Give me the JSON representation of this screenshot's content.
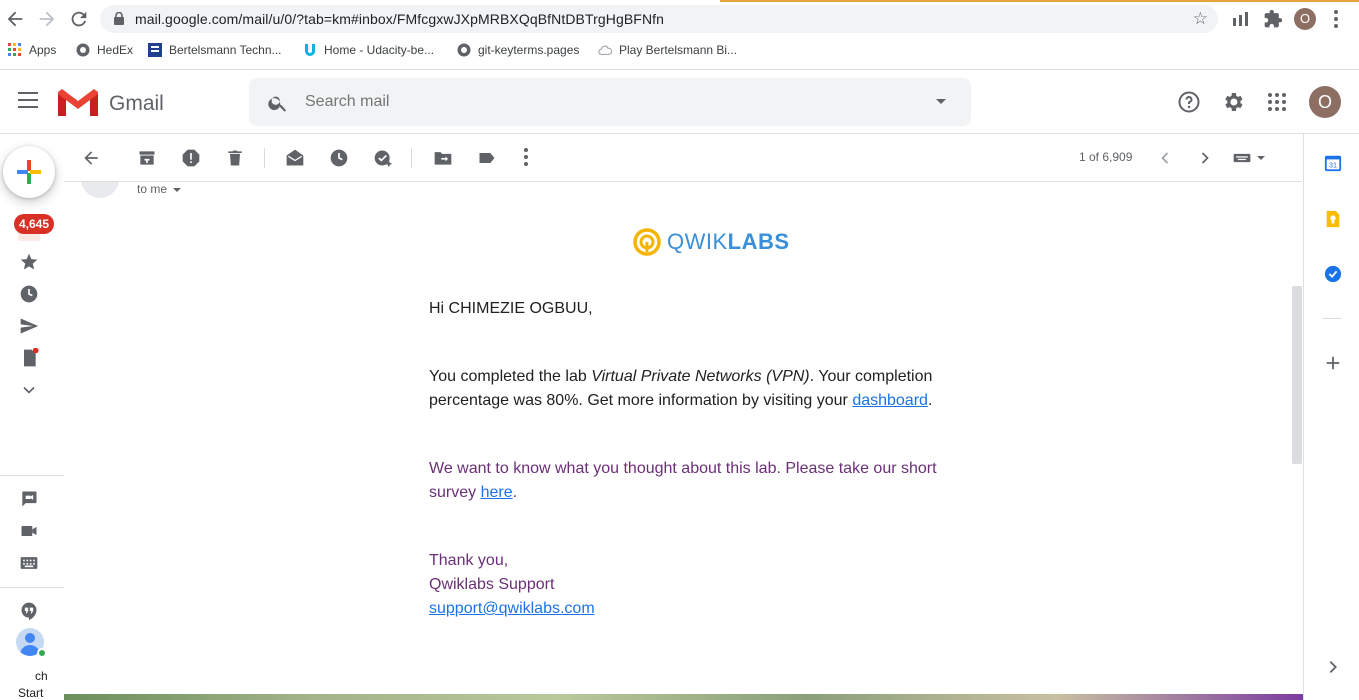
{
  "browser": {
    "url": "mail.google.com/mail/u/0/?tab=km#inbox/FMfcgxwJXpMRBXQqBfNtDBTrgHgBFNfn",
    "profile_initial": "O",
    "bookmarks": [
      {
        "label": "Apps"
      },
      {
        "label": "HedEx"
      },
      {
        "label": "Bertelsmann Techn..."
      },
      {
        "label": "Home - Udacity-be..."
      },
      {
        "label": "git-keyterms.pages"
      },
      {
        "label": "Play Bertelsmann Bi..."
      }
    ]
  },
  "gmail": {
    "brand": "Gmail",
    "search_placeholder": "Search mail",
    "account_initial": "O",
    "inbox_count": "4,645",
    "pager": "1 of 6,909",
    "rail_bottom": {
      "ch": "ch",
      "start": "Start"
    }
  },
  "message": {
    "recipient": "to me",
    "logo": {
      "part1": "QWIK",
      "part2": "LABS"
    },
    "greeting": "Hi CHIMEZIE OGBUU,",
    "p1_start": "You completed the lab ",
    "p1_lab": "Virtual Private Networks (VPN)",
    "p1_mid": ". Your completion percentage was 80%. Get more information by visiting your ",
    "p1_link": "dashboard",
    "p1_end": ".",
    "p2_start": "We want to know what you thought about this lab. Please take our short survey ",
    "p2_link": "here",
    "p2_end": ".",
    "signoff": "Thank you,",
    "team": "Qwiklabs Support",
    "email": "support@qwiklabs.com"
  },
  "colors": {
    "accent_purple": "#6b2f78",
    "link_blue": "#1a73e8",
    "badge_red": "#d93025"
  }
}
